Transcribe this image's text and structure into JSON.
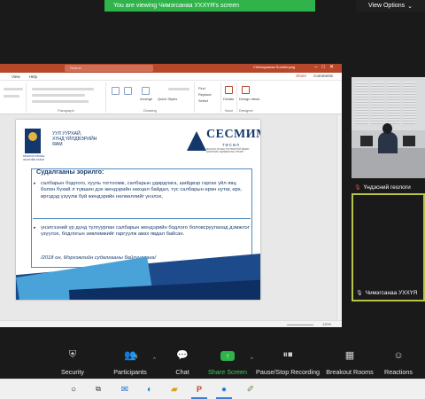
{
  "banner": {
    "message": "You are viewing Чимэгсанаа УХХҮЯ's screen",
    "view_options": "View Options",
    "view_options_caret": "⌄"
  },
  "ppt": {
    "search": "Search",
    "user": "Chimegsanaa Sumkhuyag",
    "menus": [
      "",
      "View",
      "Help"
    ],
    "share": "Share",
    "comments": "Comments",
    "ribbon_groups": [
      "Paragraph",
      "Drawing",
      "Voice",
      "Designer"
    ],
    "ribbon_items": [
      "Find",
      "Replace",
      "Select",
      "Dictate",
      "Design Ideas",
      "Arrange",
      "Quick Styles"
    ],
    "zoom_label": "110%"
  },
  "slide": {
    "emblem_caption": "МОНГОЛ УЛСЫН ЗАСГИЙН ГАЗАР",
    "ministry": "УУЛ УУРХАЙ,\nХҮНД ҮЙЛДВЭРИЙН\nЯАМ",
    "logo_name": "CECMИM",
    "logo_sub": "ТӨСӨЛ",
    "logo_line": "МОНГОЛ УЛСЫН ТОГТВОРТОЙ ЭРДЭС БАЯЛГИЙН УДИРДЛАГЫН ТӨСӨЛ",
    "title": "Судалгааны зорилго:",
    "bullet1": "салбарын бодлого, хууль тогтоомж, салбарын удирдлага, шийдвэр гаргах үйл явц болон бүхий л түвшин дэх жендэрийн нөхцөл байдал, тус салбарын өрөн нутаг, өрх, иргэдэд үзүүлж буй жендэрийн нөлөөллийг үнэлэх,",
    "bullet2": "үнэлгээний үр дүнд тулгуурлан салбарын жендэрийн бодлого боловсруулахад дэмжлэг үзүүлэх, бодлогын зөвлөмжийг гаргуулж авах явдал байсан.",
    "citation": "/2018 он, Мэргэжлийн судалгааны байгууллага/"
  },
  "participants": [
    {
      "name": "Үндэсний геологи",
      "muted": true
    },
    {
      "name": "Чимэгсанаа УХХҮЯ",
      "muted": true
    }
  ],
  "toolbar": {
    "security": "Security",
    "participants": "Participants",
    "participants_count": "6",
    "chat": "Chat",
    "share_screen": "Share Screen",
    "record": "Pause/Stop Recording",
    "breakout": "Breakout Rooms",
    "reactions": "Reactions"
  },
  "colors": {
    "share_green": "#2fb34a",
    "ppt_red": "#b7472a",
    "slide_navy": "#1b3d6e",
    "active_tile_border": "#b9c54a"
  }
}
